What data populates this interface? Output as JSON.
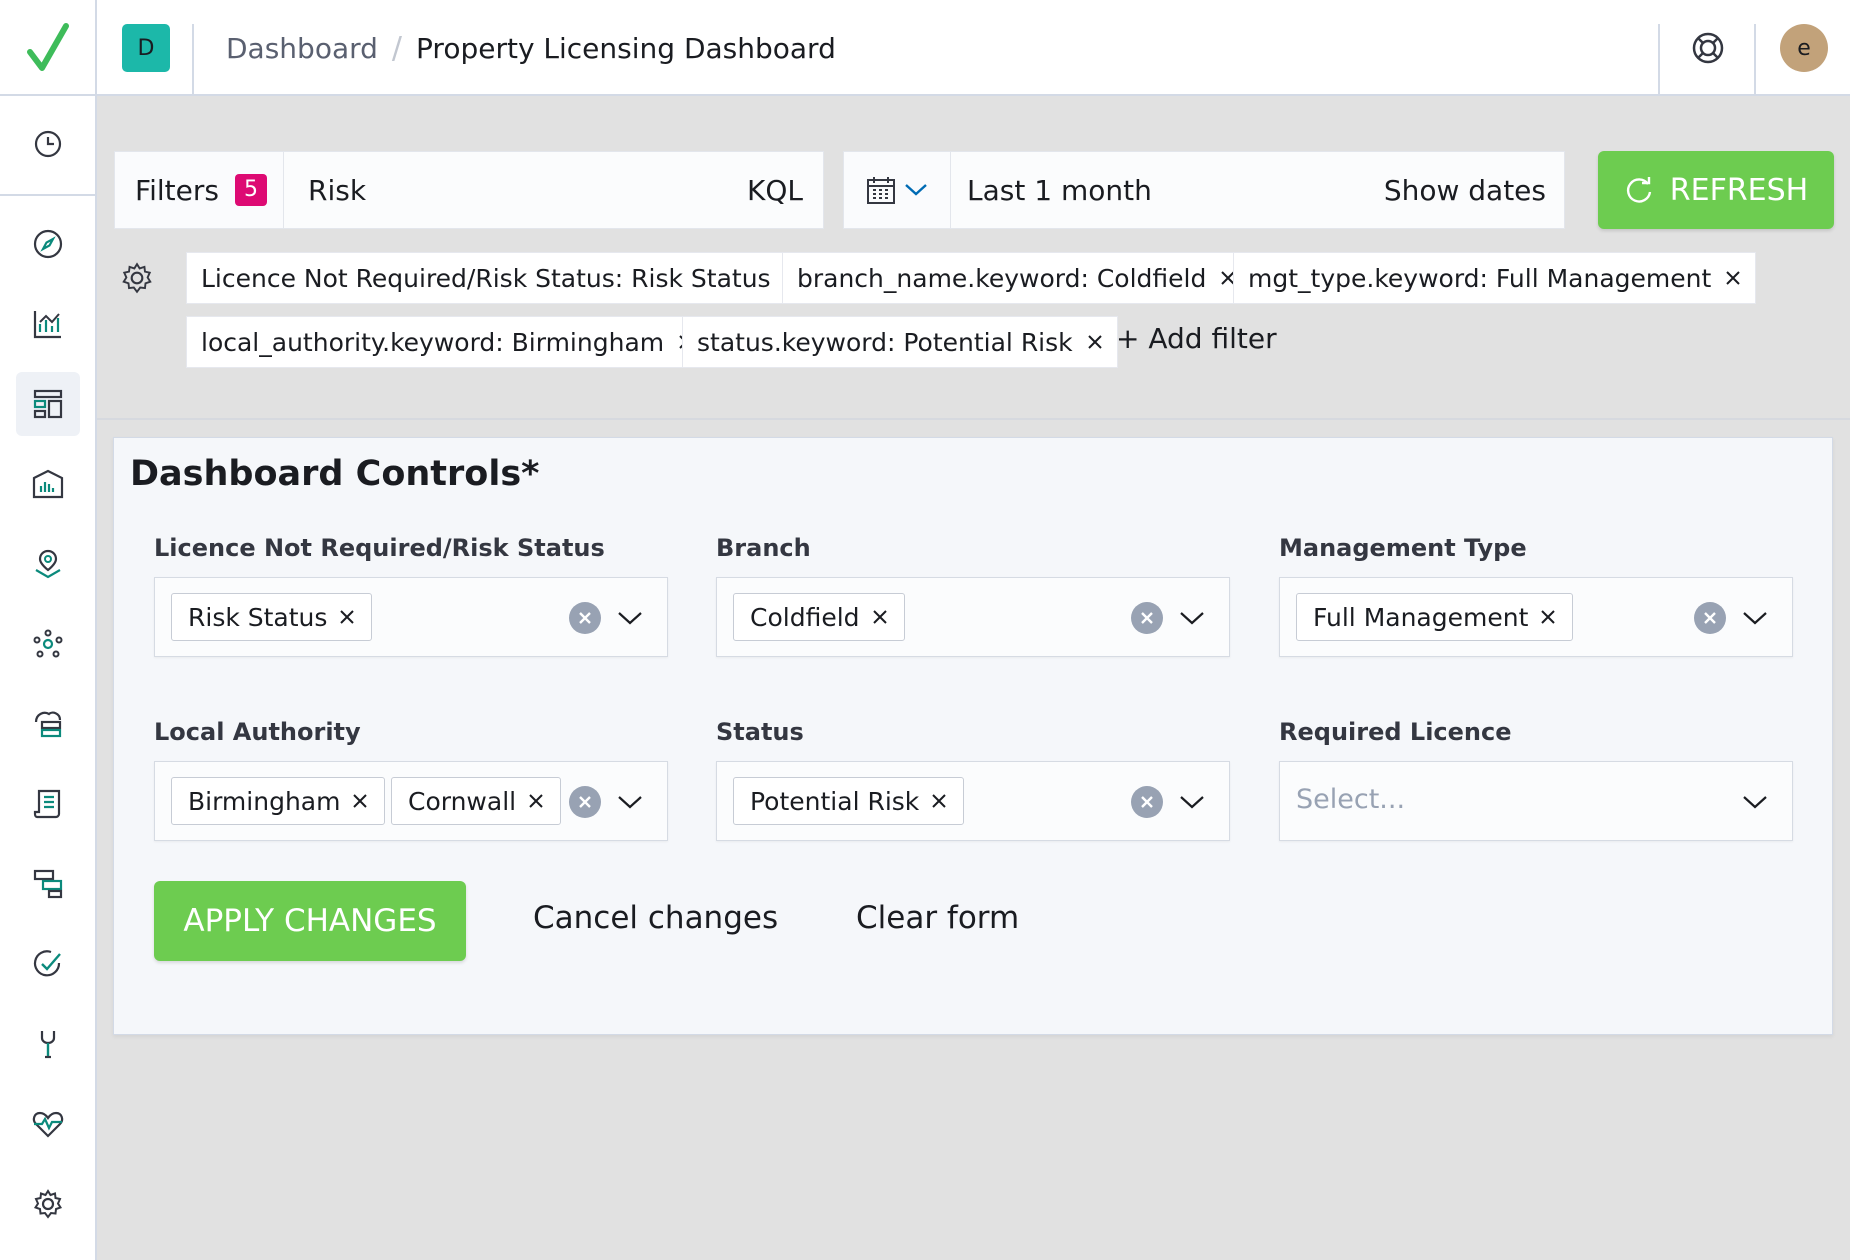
{
  "header": {
    "space_initial": "D",
    "breadcrumb_root": "Dashboard",
    "breadcrumb_separator": "/",
    "breadcrumb_current": "Property Licensing Dashboard",
    "user_initial": "e"
  },
  "sidenav": {
    "items": [
      {
        "name": "recently-viewed",
        "icon": "clock-icon"
      },
      {
        "name": "discover",
        "icon": "compass-icon"
      },
      {
        "name": "visualize",
        "icon": "chart-icon"
      },
      {
        "name": "dashboard",
        "icon": "dashboard-icon",
        "active": true
      },
      {
        "name": "canvas",
        "icon": "canvas-icon"
      },
      {
        "name": "maps",
        "icon": "map-pin-icon"
      },
      {
        "name": "machine-learning",
        "icon": "ml-icon"
      },
      {
        "name": "infrastructure",
        "icon": "infrastructure-icon"
      },
      {
        "name": "logs",
        "icon": "logs-icon"
      },
      {
        "name": "apm",
        "icon": "apm-icon"
      },
      {
        "name": "uptime",
        "icon": "uptime-icon"
      },
      {
        "name": "dev-tools",
        "icon": "wrench-icon"
      },
      {
        "name": "monitoring",
        "icon": "heartbeat-icon"
      },
      {
        "name": "management",
        "icon": "gear-icon"
      }
    ]
  },
  "query_bar": {
    "filters_label": "Filters",
    "filters_count": "5",
    "query_value": "Risk",
    "language": "KQL",
    "date_range": "Last 1 month",
    "show_dates": "Show dates",
    "refresh_label": "REFRESH"
  },
  "filter_pills": [
    "Licence Not Required/Risk Status: Risk Status",
    "branch_name.keyword: Coldfield",
    "mgt_type.keyword: Full Management",
    "local_authority.keyword: Birmingham",
    "status.keyword: Potential Risk"
  ],
  "add_filter_label": "+ Add filter",
  "panel": {
    "title": "Dashboard Controls*",
    "controls": [
      {
        "label": "Licence Not Required/Risk Status",
        "chips": [
          "Risk Status"
        ]
      },
      {
        "label": "Branch",
        "chips": [
          "Coldfield"
        ]
      },
      {
        "label": "Management Type",
        "chips": [
          "Full Management"
        ]
      },
      {
        "label": "Local Authority",
        "chips": [
          "Birmingham",
          "Cornwall"
        ]
      },
      {
        "label": "Status",
        "chips": [
          "Potential Risk"
        ]
      },
      {
        "label": "Required Licence",
        "placeholder": "Select..."
      }
    ],
    "apply_label": "APPLY CHANGES",
    "cancel_label": "Cancel changes",
    "clear_label": "Clear form"
  },
  "colors": {
    "accent_green": "#6dcc50",
    "badge_pink": "#dd0a73",
    "space_teal": "#1cb8a9",
    "icon_teal": "#0b8a7c"
  }
}
